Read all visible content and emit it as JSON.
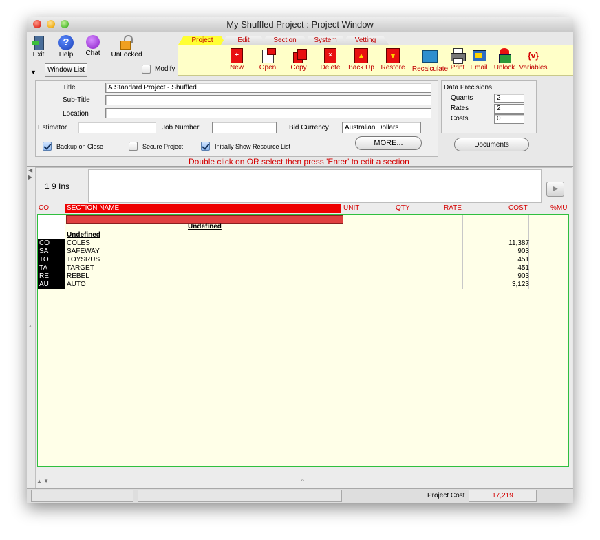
{
  "window": {
    "title": "My Shuffled Project : Project Window"
  },
  "left_toolbar": {
    "exit": "Exit",
    "help": "Help",
    "chat": "Chat",
    "unlocked": "UnLocked",
    "window_list": "Window List",
    "modify": "Modify"
  },
  "tabs": [
    {
      "label": "Project",
      "active": true
    },
    {
      "label": "Edit",
      "active": false
    },
    {
      "label": "Section",
      "active": false
    },
    {
      "label": "System",
      "active": false
    },
    {
      "label": "Vetting",
      "active": false
    }
  ],
  "ribbon": {
    "new": "New",
    "open": "Open",
    "copy": "Copy",
    "delete": "Delete",
    "backup": "Back Up",
    "restore": "Restore",
    "recalculate": "Recalculate",
    "print": "Print",
    "email": "Email",
    "unlock": "Unlock",
    "variables": "Variables",
    "variables_icon_text": "{v}"
  },
  "form": {
    "title_label": "Title",
    "title_value": "A Standard Project - Shuffled",
    "subtitle_label": "Sub-Title",
    "subtitle_value": "",
    "location_label": "Location",
    "location_value": "",
    "estimator_label": "Estimator",
    "estimator_value": "",
    "job_number_label": "Job Number",
    "job_number_value": "",
    "bid_currency_label": "Bid Currency",
    "bid_currency_value": "Australian Dollars",
    "backup_on_close": "Backup on Close",
    "secure_project": "Secure Project",
    "show_resource_list": "Initially Show Resource List",
    "more_button": "MORE..."
  },
  "precisions": {
    "title": "Data Precisions",
    "quants_label": "Quants",
    "quants_value": "2",
    "rates_label": "Rates",
    "rates_value": "2",
    "costs_label": "Costs",
    "costs_value": "0"
  },
  "documents_button": "Documents",
  "hint": "Double click on OR select then press 'Enter' to edit a section",
  "insert_bar": {
    "text": "1  9  Ins"
  },
  "table": {
    "headers": {
      "co": "CO",
      "section_name": "SECTION NAME",
      "unit": "UNIT",
      "qty": "QTY",
      "rate": "RATE",
      "cost": "COST",
      "mu": "%MU"
    },
    "group_title": "Undefined",
    "subgroup_title": "Undefined",
    "rows": [
      {
        "co": "CO",
        "name": "COLES",
        "cost": "11,387"
      },
      {
        "co": "SA",
        "name": "SAFEWAY",
        "cost": "903"
      },
      {
        "co": "TO",
        "name": "TOYSRUS",
        "cost": "451"
      },
      {
        "co": "TA",
        "name": "TARGET",
        "cost": "451"
      },
      {
        "co": "RE",
        "name": "REBEL",
        "cost": "903"
      },
      {
        "co": "AU",
        "name": "AUTO",
        "cost": "3,123"
      }
    ]
  },
  "status_bar": {
    "project_cost_label": "Project Cost",
    "project_cost_value": "17,219"
  },
  "colors": {
    "accent_red": "#d40000",
    "ribbon_bg": "#ffffc8",
    "grid_bg": "#ffffe8",
    "grid_border": "#2fbf3f"
  }
}
